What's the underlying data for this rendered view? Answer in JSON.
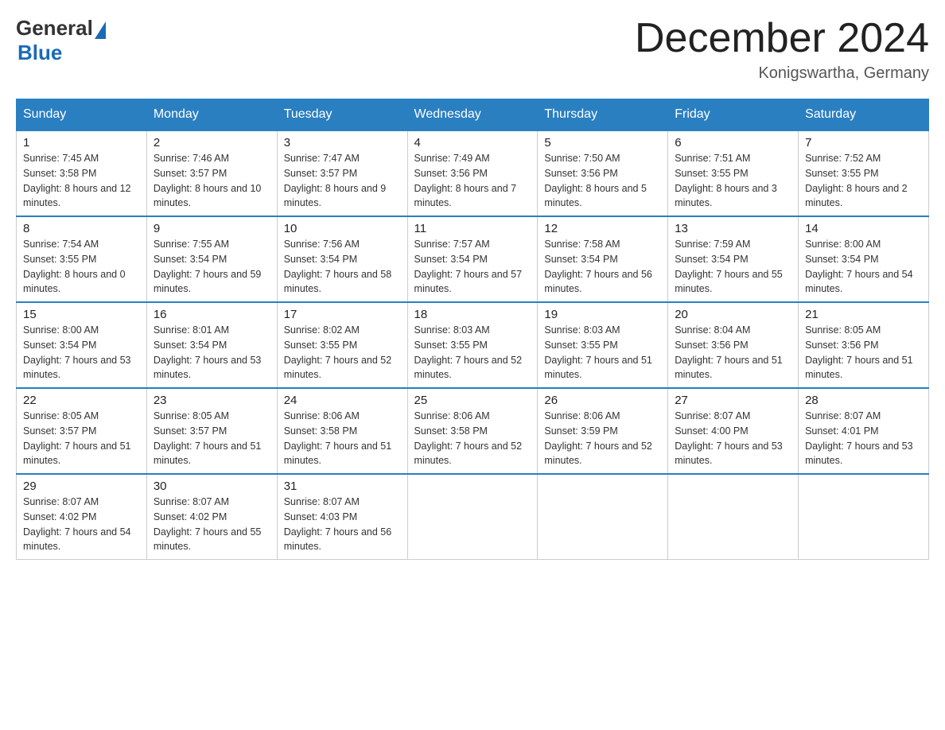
{
  "logo": {
    "general": "General",
    "blue": "Blue"
  },
  "title": {
    "month_year": "December 2024",
    "location": "Konigswartha, Germany"
  },
  "weekdays": [
    "Sunday",
    "Monday",
    "Tuesday",
    "Wednesday",
    "Thursday",
    "Friday",
    "Saturday"
  ],
  "weeks": [
    [
      {
        "day": 1,
        "sunrise": "7:45 AM",
        "sunset": "3:58 PM",
        "daylight": "8 hours and 12 minutes."
      },
      {
        "day": 2,
        "sunrise": "7:46 AM",
        "sunset": "3:57 PM",
        "daylight": "8 hours and 10 minutes."
      },
      {
        "day": 3,
        "sunrise": "7:47 AM",
        "sunset": "3:57 PM",
        "daylight": "8 hours and 9 minutes."
      },
      {
        "day": 4,
        "sunrise": "7:49 AM",
        "sunset": "3:56 PM",
        "daylight": "8 hours and 7 minutes."
      },
      {
        "day": 5,
        "sunrise": "7:50 AM",
        "sunset": "3:56 PM",
        "daylight": "8 hours and 5 minutes."
      },
      {
        "day": 6,
        "sunrise": "7:51 AM",
        "sunset": "3:55 PM",
        "daylight": "8 hours and 3 minutes."
      },
      {
        "day": 7,
        "sunrise": "7:52 AM",
        "sunset": "3:55 PM",
        "daylight": "8 hours and 2 minutes."
      }
    ],
    [
      {
        "day": 8,
        "sunrise": "7:54 AM",
        "sunset": "3:55 PM",
        "daylight": "8 hours and 0 minutes."
      },
      {
        "day": 9,
        "sunrise": "7:55 AM",
        "sunset": "3:54 PM",
        "daylight": "7 hours and 59 minutes."
      },
      {
        "day": 10,
        "sunrise": "7:56 AM",
        "sunset": "3:54 PM",
        "daylight": "7 hours and 58 minutes."
      },
      {
        "day": 11,
        "sunrise": "7:57 AM",
        "sunset": "3:54 PM",
        "daylight": "7 hours and 57 minutes."
      },
      {
        "day": 12,
        "sunrise": "7:58 AM",
        "sunset": "3:54 PM",
        "daylight": "7 hours and 56 minutes."
      },
      {
        "day": 13,
        "sunrise": "7:59 AM",
        "sunset": "3:54 PM",
        "daylight": "7 hours and 55 minutes."
      },
      {
        "day": 14,
        "sunrise": "8:00 AM",
        "sunset": "3:54 PM",
        "daylight": "7 hours and 54 minutes."
      }
    ],
    [
      {
        "day": 15,
        "sunrise": "8:00 AM",
        "sunset": "3:54 PM",
        "daylight": "7 hours and 53 minutes."
      },
      {
        "day": 16,
        "sunrise": "8:01 AM",
        "sunset": "3:54 PM",
        "daylight": "7 hours and 53 minutes."
      },
      {
        "day": 17,
        "sunrise": "8:02 AM",
        "sunset": "3:55 PM",
        "daylight": "7 hours and 52 minutes."
      },
      {
        "day": 18,
        "sunrise": "8:03 AM",
        "sunset": "3:55 PM",
        "daylight": "7 hours and 52 minutes."
      },
      {
        "day": 19,
        "sunrise": "8:03 AM",
        "sunset": "3:55 PM",
        "daylight": "7 hours and 51 minutes."
      },
      {
        "day": 20,
        "sunrise": "8:04 AM",
        "sunset": "3:56 PM",
        "daylight": "7 hours and 51 minutes."
      },
      {
        "day": 21,
        "sunrise": "8:05 AM",
        "sunset": "3:56 PM",
        "daylight": "7 hours and 51 minutes."
      }
    ],
    [
      {
        "day": 22,
        "sunrise": "8:05 AM",
        "sunset": "3:57 PM",
        "daylight": "7 hours and 51 minutes."
      },
      {
        "day": 23,
        "sunrise": "8:05 AM",
        "sunset": "3:57 PM",
        "daylight": "7 hours and 51 minutes."
      },
      {
        "day": 24,
        "sunrise": "8:06 AM",
        "sunset": "3:58 PM",
        "daylight": "7 hours and 51 minutes."
      },
      {
        "day": 25,
        "sunrise": "8:06 AM",
        "sunset": "3:58 PM",
        "daylight": "7 hours and 52 minutes."
      },
      {
        "day": 26,
        "sunrise": "8:06 AM",
        "sunset": "3:59 PM",
        "daylight": "7 hours and 52 minutes."
      },
      {
        "day": 27,
        "sunrise": "8:07 AM",
        "sunset": "4:00 PM",
        "daylight": "7 hours and 53 minutes."
      },
      {
        "day": 28,
        "sunrise": "8:07 AM",
        "sunset": "4:01 PM",
        "daylight": "7 hours and 53 minutes."
      }
    ],
    [
      {
        "day": 29,
        "sunrise": "8:07 AM",
        "sunset": "4:02 PM",
        "daylight": "7 hours and 54 minutes."
      },
      {
        "day": 30,
        "sunrise": "8:07 AM",
        "sunset": "4:02 PM",
        "daylight": "7 hours and 55 minutes."
      },
      {
        "day": 31,
        "sunrise": "8:07 AM",
        "sunset": "4:03 PM",
        "daylight": "7 hours and 56 minutes."
      },
      null,
      null,
      null,
      null
    ]
  ],
  "labels": {
    "sunrise": "Sunrise:",
    "sunset": "Sunset:",
    "daylight": "Daylight:"
  }
}
